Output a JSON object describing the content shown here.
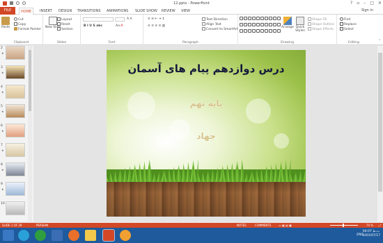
{
  "window": {
    "title": "12.pptx - PowerPoint",
    "signin": "Sign in"
  },
  "tabs": [
    "FILE",
    "HOME",
    "INSERT",
    "DESIGN",
    "TRANSITIONS",
    "ANIMATIONS",
    "SLIDE SHOW",
    "REVIEW",
    "VIEW"
  ],
  "ribbon": {
    "clipboard": {
      "label": "Clipboard",
      "paste": "Paste",
      "cut": "Cut",
      "copy": "Copy",
      "format_painter": "Format Painter"
    },
    "slides": {
      "label": "Slides",
      "new_slide": "New Slide",
      "layout": "Layout",
      "reset": "Reset",
      "section": "Section"
    },
    "font": {
      "label": "Font"
    },
    "paragraph": {
      "label": "Paragraph",
      "text_direction": "Text Direction",
      "align_text": "Align Text",
      "convert_smartart": "Convert to SmartArt"
    },
    "drawing": {
      "label": "Drawing",
      "arrange": "Arrange",
      "quick_styles": "Quick Styles",
      "shape_fill": "Shape Fill",
      "shape_outline": "Shape Outline",
      "shape_effects": "Shape Effects"
    },
    "editing": {
      "label": "Editing",
      "find": "Find",
      "replace": "Replace",
      "select": "Select"
    }
  },
  "thumbnails": [
    "2",
    "3",
    "4",
    "5",
    "6",
    "7",
    "8",
    "9",
    "10"
  ],
  "slide": {
    "title": "درس دوازدهم پیام های آسمان",
    "subtitle1": "پایه نهم",
    "subtitle2": "جهاد"
  },
  "statusbar": {
    "slide_info": "SLIDE 1 OF 29",
    "language": "PERSIAN",
    "notes": "NOTES",
    "comments": "COMMENTS",
    "zoom": "74 %"
  },
  "taskbar": {
    "lang": "ENG",
    "time": "04:07 ب.ظ",
    "date": "1401/07/17"
  },
  "colors": {
    "accent": "#d24726",
    "taskbar": "#1e5a9c"
  }
}
